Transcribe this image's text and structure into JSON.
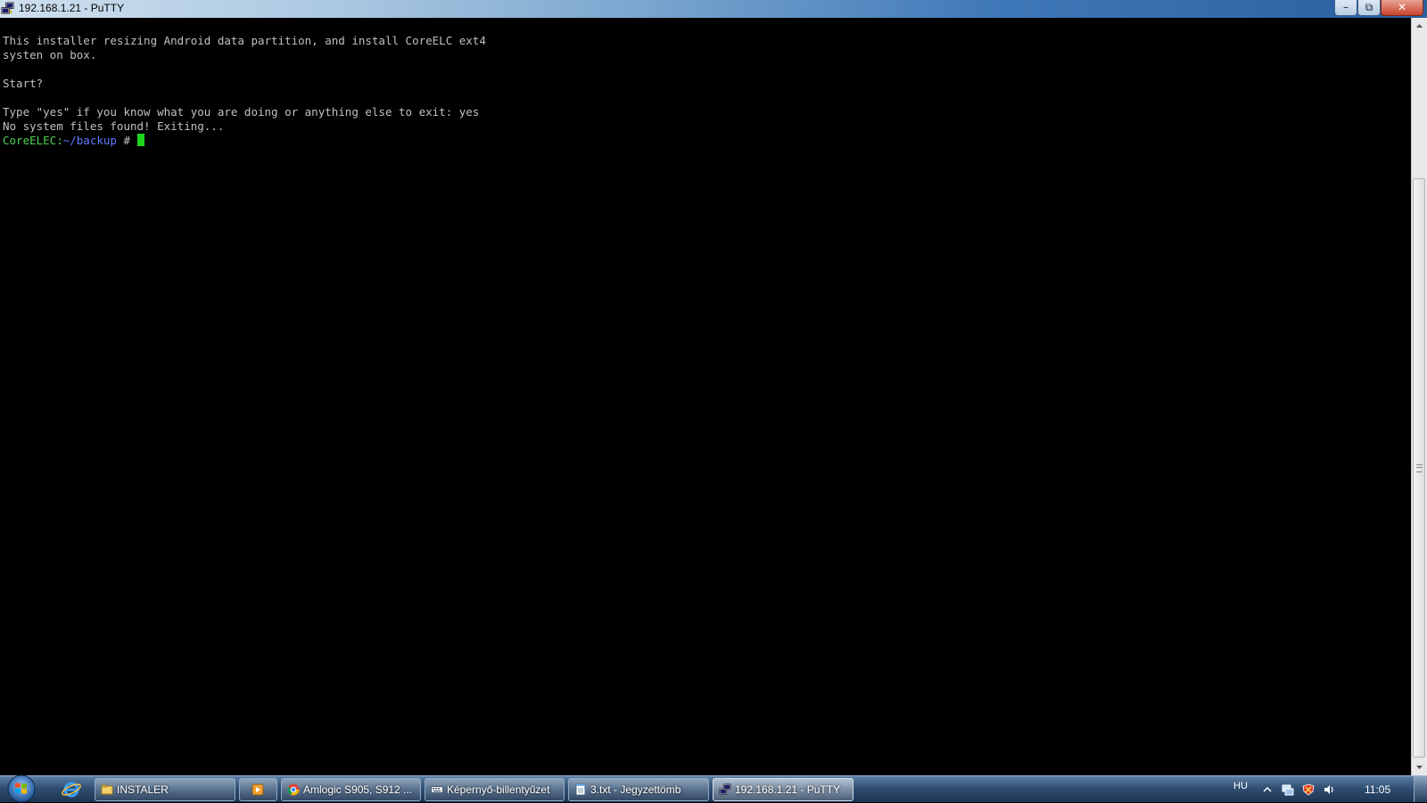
{
  "window": {
    "title": "192.168.1.21 - PuTTY",
    "controls": {
      "minimize": "minimize-icon",
      "maximize": "restore-icon",
      "close": "close-icon"
    }
  },
  "terminal": {
    "lines": [
      "This installer resizing Android data partition, and install CoreELC ext4",
      "systen on box.",
      "",
      "Start?",
      "",
      "Type \"yes\" if you know what you are doing or anything else to exit: yes",
      "No system files found! Exiting..."
    ],
    "prompt_host": "CoreELEC:",
    "prompt_path": "~/backup",
    "prompt_suffix": " # ",
    "colors": {
      "text": "#c0c0c0",
      "host": "#4fd34f",
      "path": "#5f7cff",
      "cursor": "#1ed61e",
      "background": "#000000"
    }
  },
  "taskbar": {
    "start_icon": "windows-orb-icon",
    "quicklaunch": [
      {
        "name": "internet-explorer-icon"
      }
    ],
    "buttons": [
      {
        "label": "INSTALER",
        "icon": "folder-icon",
        "active": false
      },
      {
        "label": "",
        "icon": "media-player-icon",
        "active": false
      },
      {
        "label": "Amlogic S905, S912 ...",
        "icon": "chrome-icon",
        "active": false
      },
      {
        "label": "Képernyő-billentyűzet",
        "icon": "keyboard-icon",
        "active": false
      },
      {
        "label": "3.txt - Jegyzettömb",
        "icon": "notepad-icon",
        "active": false
      },
      {
        "label": "192.168.1.21 - PuTTY",
        "icon": "putty-icon",
        "active": true
      }
    ],
    "tray": {
      "language": "HU",
      "clock": "11:05",
      "icons": [
        "show-hidden-icons-arrow",
        "network-icon",
        "security-icon",
        "volume-icon"
      ]
    }
  }
}
